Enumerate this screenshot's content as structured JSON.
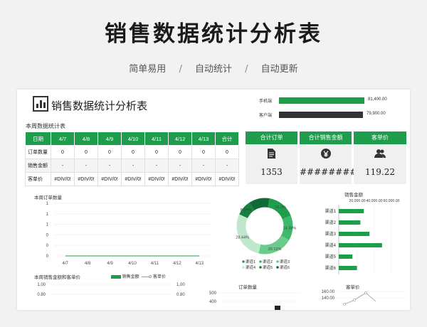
{
  "page": {
    "title": "销售数据统计分析表",
    "tags": [
      "简单易用",
      "自动统计",
      "自动更新"
    ],
    "sep": "/"
  },
  "sheet": {
    "title": "销售数据统计分析表",
    "section_label": "本周数据统计表",
    "icon": "bar-chart-icon"
  },
  "top_bars": [
    {
      "label": "手机端",
      "value": "81,400.00",
      "color": "#1e9e4c",
      "fraction": 1.0
    },
    {
      "label": "客户端",
      "value": "79,900.00",
      "color": "#333333",
      "fraction": 0.98
    }
  ],
  "table": {
    "headers": [
      "日期",
      "4/7",
      "4/8",
      "4/9",
      "4/10",
      "4/11",
      "4/12",
      "4/13",
      "合计"
    ],
    "rows": [
      {
        "label": "订单数量",
        "cells": [
          "0",
          "0",
          "0",
          "0",
          "0",
          "0",
          "0",
          "0"
        ]
      },
      {
        "label": "销售金额",
        "cells": [
          "-",
          "-",
          "-",
          "-",
          "-",
          "-",
          "-",
          "-"
        ]
      },
      {
        "label": "客单价",
        "cells": [
          "#DIV/0!",
          "#DIV/0!",
          "#DIV/0!",
          "#DIV/0!",
          "#DIV/0!",
          "#DIV/0!",
          "#DIV/0!",
          "#DIV/0!"
        ]
      }
    ]
  },
  "kpis": [
    {
      "label": "合计订单",
      "icon": "document-icon",
      "value": "1353"
    },
    {
      "label": "合计销售金额",
      "icon": "yen-icon",
      "value": "#########"
    },
    {
      "label": "客单价",
      "icon": "users-icon",
      "value": "119.22"
    }
  ],
  "chart_data": [
    {
      "type": "line",
      "title": "本周订单数量",
      "categories": [
        "4/7",
        "4/8",
        "4/9",
        "4/10",
        "4/11",
        "4/12",
        "4/13"
      ],
      "ylim": [
        0,
        1
      ],
      "yticks": [
        "0",
        "0",
        "0",
        "1",
        "1",
        "1"
      ],
      "series": [
        {
          "values": [
            0,
            0,
            0,
            0,
            0,
            0,
            0
          ]
        }
      ]
    },
    {
      "type": "pie",
      "title": "",
      "labels": [
        "渠道1",
        "渠道2",
        "渠道3",
        "渠道4",
        "渠道5",
        "渠道6"
      ],
      "values": [
        16.34,
        14.38,
        20.12,
        28.44,
        8.84,
        11.88
      ],
      "value_labels": [
        "16.3%",
        "14.38%",
        "20.12%",
        "28.44%",
        "8.84%",
        ""
      ],
      "colors": [
        "#1e9e4c",
        "#3cb96a",
        "#69cc8c",
        "#bfe8cd",
        "#158040",
        "#0f6a33"
      ]
    },
    {
      "type": "bar",
      "title": "销售金额",
      "orientation": "horizontal",
      "categories": [
        "渠道1",
        "渠道2",
        "渠道3",
        "渠道4",
        "渠道5",
        "渠道6"
      ],
      "values": [
        22000,
        19000,
        27000,
        38000,
        12000,
        16000
      ],
      "xticks": [
        "20,000.00",
        "40,000.00",
        "60,000.00"
      ],
      "xlim": [
        0,
        60000
      ]
    },
    {
      "type": "line",
      "title": "本周销售金额和客单价",
      "legend": [
        "销售金额",
        "客单价"
      ],
      "yticks_left": [
        "1.00",
        "0.80"
      ],
      "yticks_right": [
        "1.00",
        "0.80"
      ]
    },
    {
      "type": "bar",
      "title": "订单数量",
      "yticks": [
        "500",
        "400"
      ]
    },
    {
      "type": "line",
      "title": "客单价",
      "yticks": [
        "160.00",
        "140.00"
      ]
    }
  ]
}
